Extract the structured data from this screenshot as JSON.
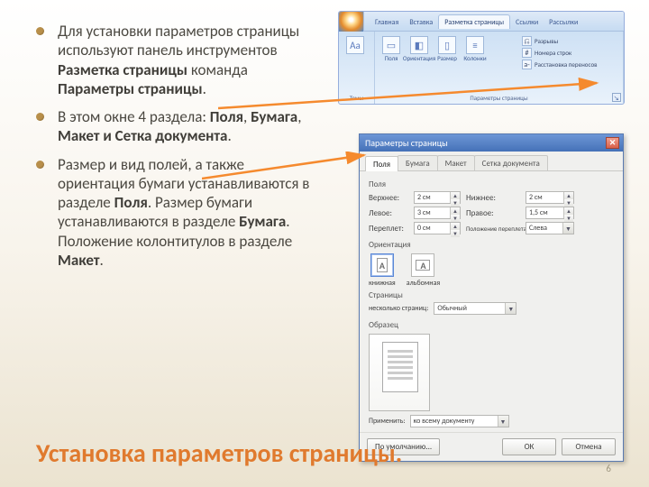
{
  "title": "Установка параметров страницы.",
  "page_number": "6",
  "bullets": [
    {
      "pre": "Для установки параметров страницы используют панель инструментов ",
      "b1": "Разметка страницы",
      "mid": " команда ",
      "b2": "Параметры страницы",
      "post": "."
    },
    {
      "pre": "В этом окне 4 раздела: ",
      "b1": "Поля",
      "mid": ", ",
      "b2": "Бумага",
      "mid2": ", ",
      "b3": "Макет и Сетка документа",
      "post": "."
    },
    {
      "pre": "Размер и вид полей, а также ориентация бумаги устанавливаются в разделе ",
      "b1": "Поля",
      "mid": ". Размер бумаги устанавливаются в разделе ",
      "b2": "Бумага",
      "mid2": ". Положение колонтитулов в разделе ",
      "b3": "Макет",
      "post": "."
    }
  ],
  "ribbon": {
    "tabs": [
      "Главная",
      "Вставка",
      "Разметка страницы",
      "Ссылки",
      "Рассылки"
    ],
    "active_tab": "Разметка страницы",
    "group_themes": "Темы",
    "group_page_setup": "Параметры страницы",
    "big_icons": [
      "Поля",
      "Ориентация",
      "Размер",
      "Колонки"
    ],
    "small_icons": [
      "Разрывы",
      "Номера строк",
      "Расстановка переносов"
    ]
  },
  "dialog": {
    "title": "Параметры страницы",
    "tabs": [
      "Поля",
      "Бумага",
      "Макет",
      "Сетка документа"
    ],
    "active_tab": "Поля",
    "section_margins": "Поля",
    "fields": {
      "top_lbl": "Верхнее:",
      "top_val": "2 см",
      "bottom_lbl": "Нижнее:",
      "bottom_val": "2 см",
      "left_lbl": "Левое:",
      "left_val": "3 см",
      "right_lbl": "Правое:",
      "right_val": "1,5 см",
      "gutter_lbl": "Переплет:",
      "gutter_val": "0 см",
      "gutterpos_lbl": "Положение переплета:",
      "gutterpos_val": "Слева"
    },
    "section_orientation": "Ориентация",
    "orientation": {
      "portrait": "книжная",
      "landscape": "альбомная",
      "selected": "portrait"
    },
    "section_pages": "Страницы",
    "pages_lbl": "несколько страниц:",
    "pages_val": "Обычный",
    "section_preview": "Образец",
    "apply_lbl": "Применить:",
    "apply_val": "ко всему документу",
    "default_btn": "По умолчанию...",
    "ok_btn": "ОК",
    "cancel_btn": "Отмена"
  }
}
